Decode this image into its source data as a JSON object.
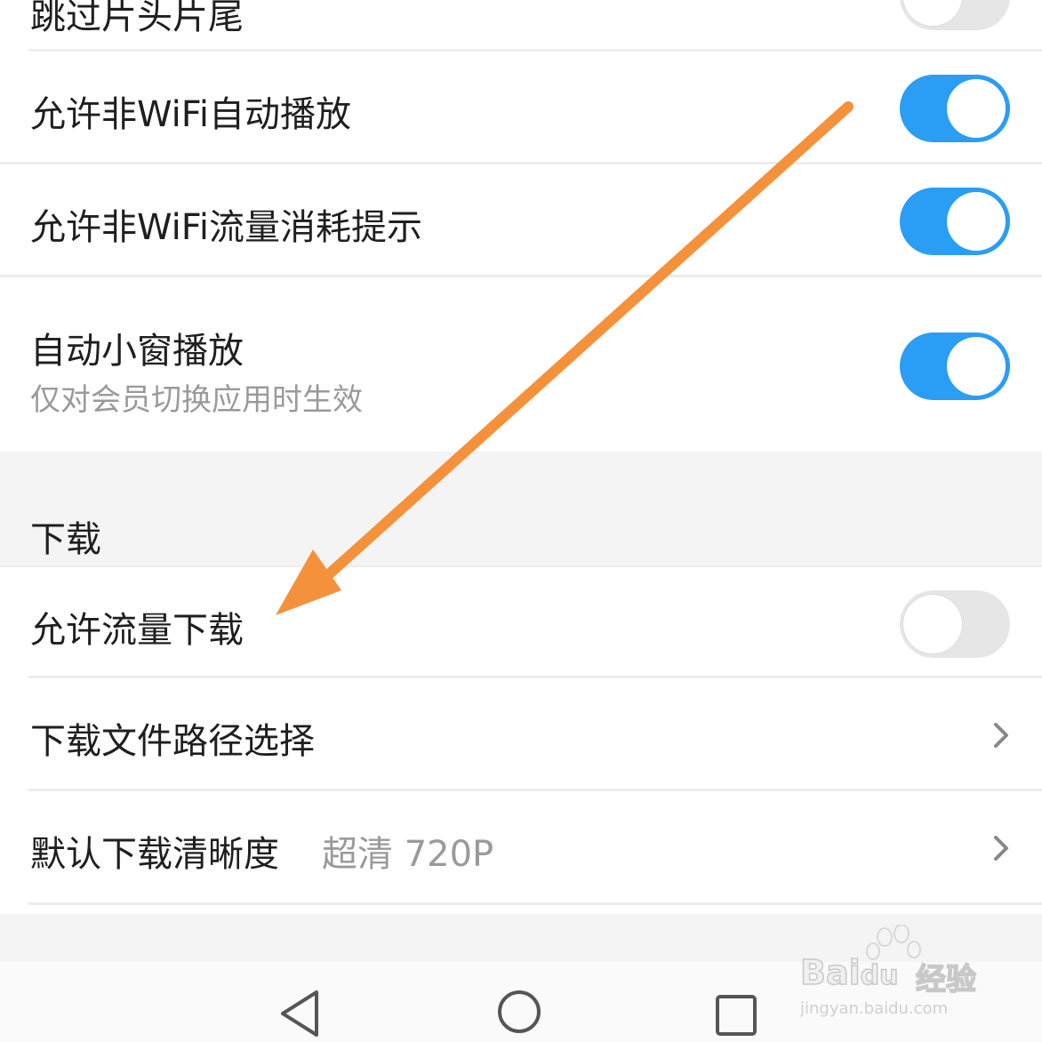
{
  "settings": {
    "skip_intro_label": "跳过片头片尾",
    "wifi_autoplay_label": "允许非WiFi自动播放",
    "wifi_data_prompt_label": "允许非WiFi流量消耗提示",
    "mini_window_label": "自动小窗播放",
    "mini_window_sublabel": "仅对会员切换应用时生效",
    "skip_intro_on": false,
    "wifi_autoplay_on": true,
    "wifi_data_prompt_on": true,
    "mini_window_on": true
  },
  "download_section": {
    "title": "下载",
    "allow_data_download_label": "允许流量下载",
    "allow_data_download_on": false,
    "file_path_label": "下载文件路径选择",
    "default_quality_label": "默认下载清晰度",
    "default_quality_value": "超清 720P"
  },
  "nav": {
    "back_icon": "back-triangle-icon",
    "home_icon": "home-circle-icon",
    "recents_icon": "recents-square-icon"
  },
  "watermark": {
    "brand": "Bai",
    "brand_du": "du",
    "jingyan": "经验",
    "url": "jingyan.baidu.com"
  },
  "colors": {
    "toggle_on": "#2a9df4",
    "toggle_off": "#e6e6e6",
    "annotation_arrow": "#f5913a",
    "section_background": "#f4f4f4"
  }
}
